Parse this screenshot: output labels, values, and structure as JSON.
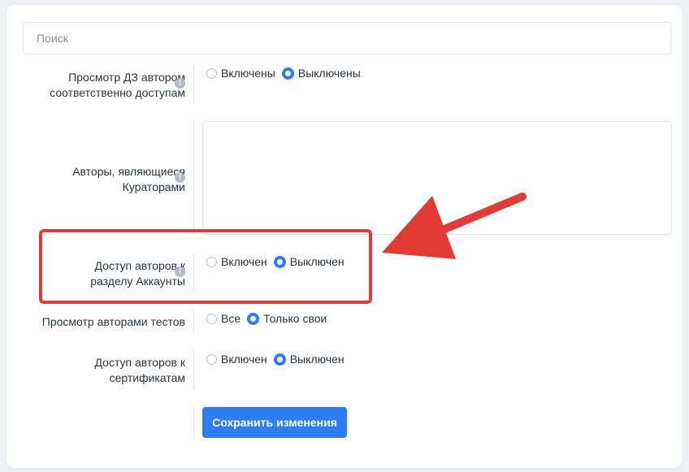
{
  "search": {
    "placeholder": "Поиск"
  },
  "settings": {
    "homework_view": {
      "label": "Просмотр ДЗ автором соответственно доступам",
      "label_line1": "Просмотр ДЗ автором",
      "label_line2": "соответственно доступам",
      "options": [
        "Включены",
        "Выключены"
      ],
      "selected": "Выключены"
    },
    "curator_authors": {
      "label_line1": "Авторы, являющиеся",
      "label_line2": "Кураторами",
      "value": ""
    },
    "accounts_access": {
      "label_line1": "Доступ авторов к",
      "label_line2": "разделу Аккаунты",
      "options": [
        "Включен",
        "Выключен"
      ],
      "selected": "Выключен"
    },
    "tests_view": {
      "label": "Просмотр авторами тестов",
      "options": [
        "Все",
        "Только свои"
      ],
      "selected": "Только свои"
    },
    "certificates_access": {
      "label_line1": "Доступ авторов к",
      "label_line2": "сертификатам",
      "options": [
        "Включен",
        "Выключен"
      ],
      "selected": "Выключен"
    }
  },
  "info_icon_glyph": "!",
  "save_button": {
    "label": "Сохранить изменения"
  },
  "colors": {
    "accent": "#2f7df6",
    "highlight": "#e23b35"
  },
  "icons": {
    "info": "info-icon",
    "annotation_arrow": "arrow-icon"
  }
}
